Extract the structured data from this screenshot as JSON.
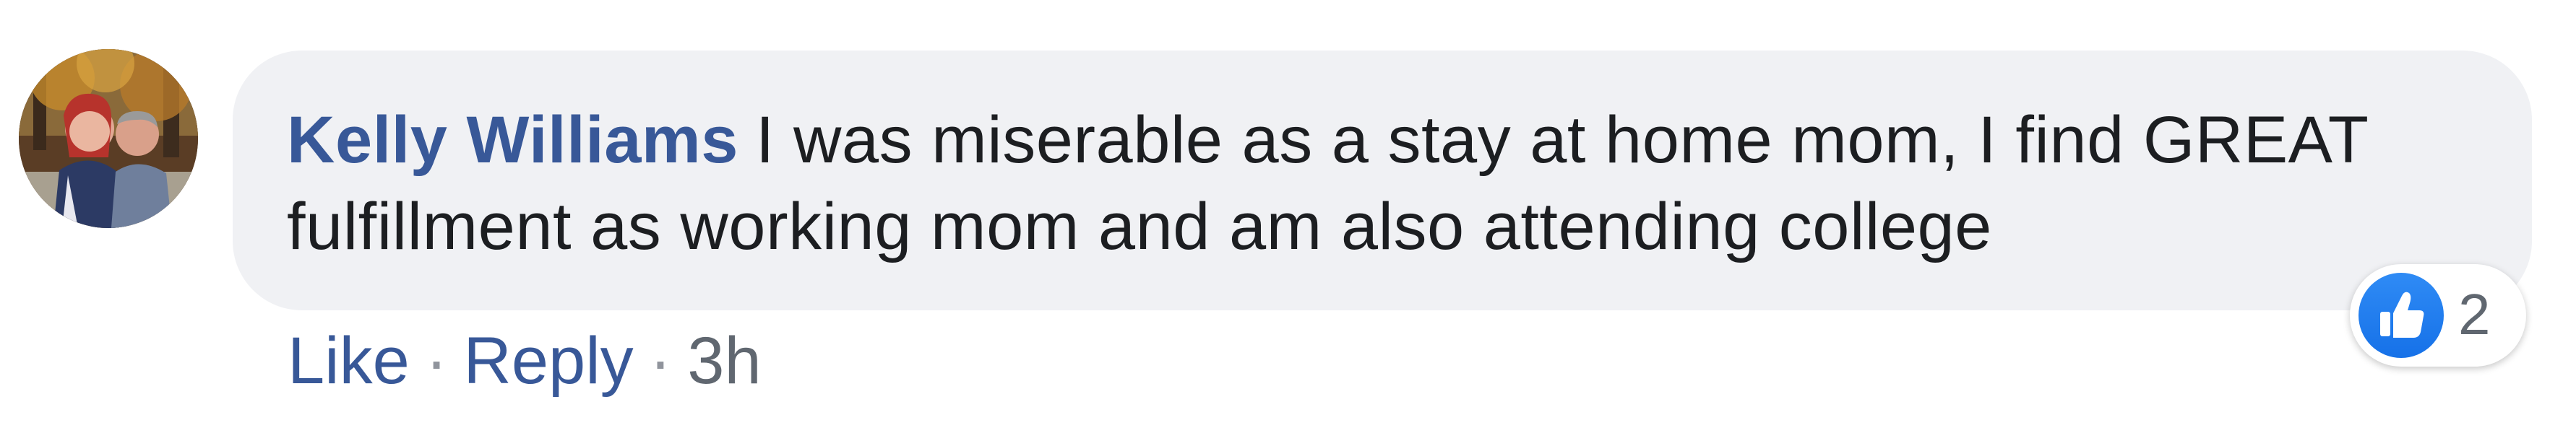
{
  "comment": {
    "author": "Kelly Williams",
    "text": "I was miserable as a stay at home mom, I find GREAT fulfillment as working mom and am also attending college",
    "reaction_count": "2",
    "reaction_icon": "like-thumb-icon",
    "avatar_icon": "profile-photo"
  },
  "actions": {
    "like_label": "Like",
    "reply_label": "Reply",
    "separator": "·",
    "timestamp": "3h"
  },
  "colors": {
    "link_blue": "#385898",
    "bubble_bg": "#f0f1f4",
    "text_dark": "#1c1e21",
    "meta_gray": "#606770",
    "like_blue": "#1877f2"
  }
}
